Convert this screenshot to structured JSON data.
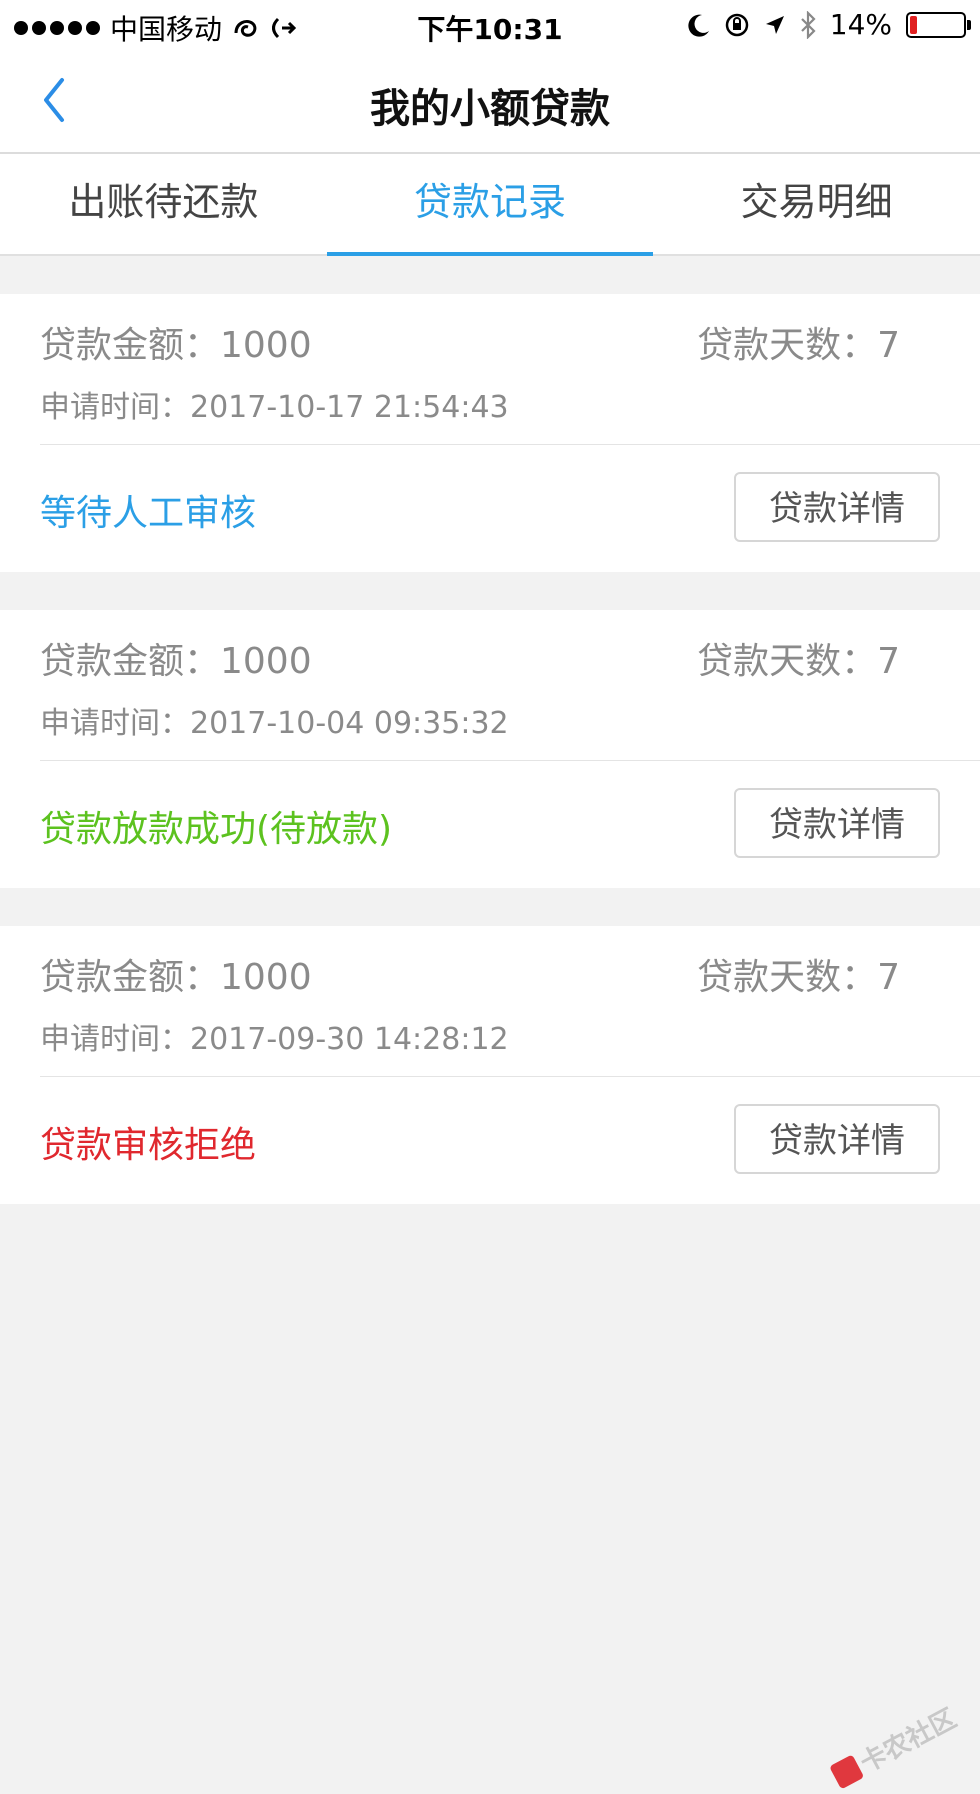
{
  "status_bar": {
    "carrier": "中国移动",
    "time": "下午10:31",
    "battery": "14%",
    "battery_level": 0.14
  },
  "nav": {
    "title": "我的小额贷款"
  },
  "tabs": [
    {
      "label": "出账待还款",
      "active": false
    },
    {
      "label": "贷款记录",
      "active": true
    },
    {
      "label": "交易明细",
      "active": false
    }
  ],
  "records": [
    {
      "amount": "贷款金额：1000",
      "days": "贷款天数：7",
      "time": "申请时间：2017-10-17 21:54:43",
      "status": "等待人工审核",
      "status_color": "#2b9fe6",
      "button": "贷款详情"
    },
    {
      "amount": "贷款金额：1000",
      "days": "贷款天数：7",
      "time": "申请时间：2017-10-04 09:35:32",
      "status": "贷款放款成功(待放款)",
      "status_color": "#5cc21f",
      "button": "贷款详情"
    },
    {
      "amount": "贷款金额：1000",
      "days": "贷款天数：7",
      "time": "申请时间：2017-09-30 14:28:12",
      "status": "贷款审核拒绝",
      "status_color": "#e0282e",
      "button": "贷款详情"
    }
  ],
  "watermark": {
    "text": "卡农社区"
  },
  "colors": {
    "accent": "#2b9fe6",
    "background": "#f2f2f2"
  }
}
